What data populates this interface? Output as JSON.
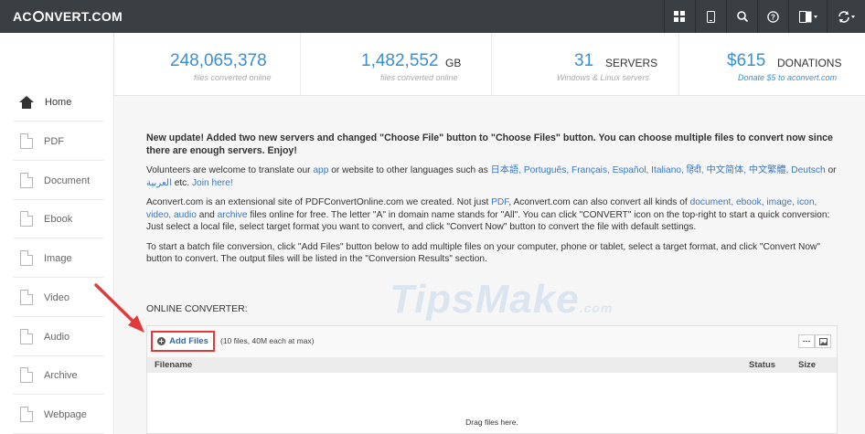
{
  "brand": {
    "prefix": "AC",
    "suffix": "NVERT.COM"
  },
  "topbar": {
    "icons": [
      "grid-icon",
      "mobile-icon",
      "search-icon",
      "help-icon",
      "language-icon",
      "convert-icon"
    ]
  },
  "sidebar": {
    "items": [
      {
        "label": "Home",
        "icon": "home-icon"
      },
      {
        "label": "PDF",
        "icon": "pdf-file-icon"
      },
      {
        "label": "Document",
        "icon": "document-file-icon"
      },
      {
        "label": "Ebook",
        "icon": "ebook-file-icon"
      },
      {
        "label": "Image",
        "icon": "image-file-icon"
      },
      {
        "label": "Video",
        "icon": "video-file-icon"
      },
      {
        "label": "Audio",
        "icon": "audio-file-icon"
      },
      {
        "label": "Archive",
        "icon": "archive-file-icon"
      },
      {
        "label": "Webpage",
        "icon": "webpage-file-icon"
      }
    ]
  },
  "stats": {
    "files": {
      "value": "248,065,378",
      "sub": "files converted online"
    },
    "size": {
      "value": "1,482,552",
      "unit": "GB",
      "sub": "files converted online"
    },
    "servers": {
      "value": "31",
      "unit": "SERVERS",
      "sub": "Windows & Linux servers"
    },
    "donations": {
      "value": "$615",
      "unit": "DONATIONS",
      "sub": "Donate $5 to aconvert.com"
    }
  },
  "content": {
    "update": "New update! Added two new servers and changed \"Choose File\" button to \"Choose Files\" button. You can choose multiple files to convert now since there are enough servers. Enjoy!",
    "volunteers_pre": "Volunteers are welcome to translate our",
    "app_link": "app",
    "volunteers_mid": "or website to other languages such as",
    "languages": "日本語, Português, Français, Español, Italiano, हिंदी, 中文简体, 中文繁體, Deutsch",
    "or_word": "or",
    "arabic": "العربية",
    "etc": "etc.",
    "join": "Join here!",
    "about_pre": "Aconvert.com is an extensional site of PDFConvertOnline.com we created. Not just",
    "pdf_link": "PDF",
    "about_mid": ", Aconvert.com can also convert all kinds of",
    "kinds_links": "document, ebook, image, icon, video, audio",
    "and_word": "and",
    "archive_link": "archive",
    "about_post": "files online for free. The letter \"A\" in domain name stands for \"All\". You can click \"CONVERT\" icon on the top-right to start a quick conversion: Just select a local file, select target format you want to convert, and click \"Convert Now\" button to convert the file with default settings.",
    "batch": "To start a batch file conversion, click \"Add Files\" button below to add multiple files on your computer, phone or tablet, select a target format, and click \"Convert Now\" button to convert. The output files will be listed in the \"Conversion Results\" section."
  },
  "converter": {
    "label": "ONLINE CONVERTER:",
    "add_files": "Add Files",
    "limit": "(10 files, 40M each at max)",
    "columns": {
      "filename": "Filename",
      "status": "Status",
      "size": "Size"
    },
    "drag": "Drag files here."
  },
  "watermark": {
    "main": "TipsMake",
    "com": ".com"
  },
  "colors": {
    "accent": "#3a8fd0",
    "topbar": "#3a3f44",
    "highlight": "#e03a3a"
  }
}
